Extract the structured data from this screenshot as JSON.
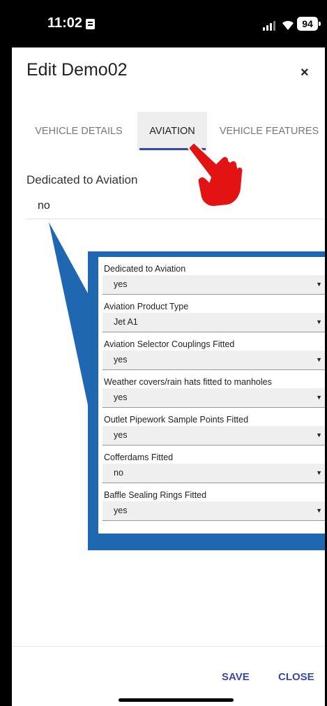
{
  "status_bar": {
    "time": "11:02",
    "battery": "94"
  },
  "dialog": {
    "title": "Edit Demo02",
    "close_icon": "×",
    "tabs": [
      {
        "label": "VEHICLE DETAILS"
      },
      {
        "label": "AVIATION"
      },
      {
        "label": "VEHICLE FEATURES"
      }
    ],
    "active_tab": "AVIATION",
    "field": {
      "label": "Dedicated to Aviation",
      "value": "no"
    },
    "footer": {
      "save_label": "SAVE",
      "close_label": "CLOSE"
    }
  },
  "callout": {
    "fields": [
      {
        "label": "Dedicated to Aviation",
        "value": "yes"
      },
      {
        "label": "Aviation Product Type",
        "value": "Jet A1"
      },
      {
        "label": "Aviation Selector Couplings Fitted",
        "value": "yes"
      },
      {
        "label": "Weather covers/rain hats fitted to manholes",
        "value": "yes"
      },
      {
        "label": "Outlet Pipework Sample Points Fitted",
        "value": "yes"
      },
      {
        "label": "Cofferdams Fitted",
        "value": "no"
      },
      {
        "label": "Baffle Sealing Rings Fitted",
        "value": "yes"
      }
    ],
    "caret": "▼"
  },
  "colors": {
    "accent": "#3a4a9a",
    "callout_blue": "#1f67b1",
    "pointer_red": "#e31313"
  },
  "icons": {
    "pointer": "pointing-hand-icon",
    "close": "close-icon",
    "dropdown": "chevron-down-icon"
  }
}
